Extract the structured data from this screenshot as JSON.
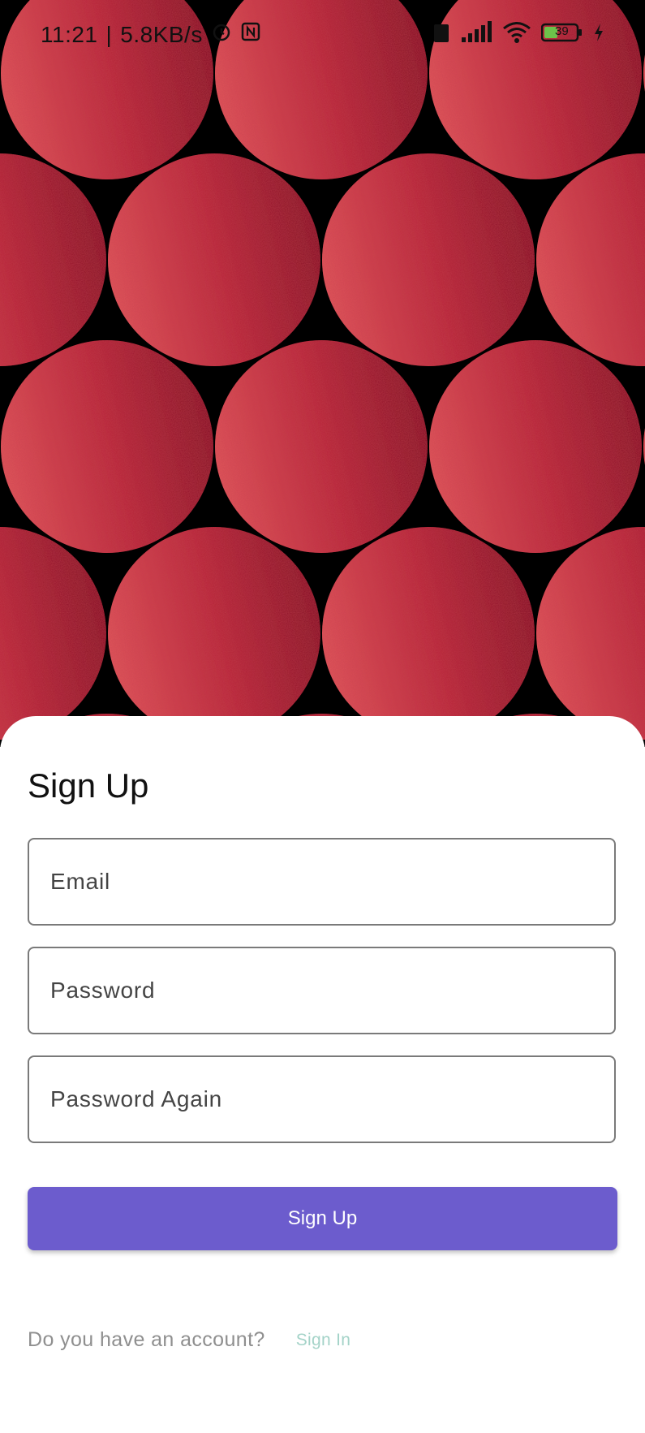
{
  "status_bar": {
    "time": "11:21",
    "separator": "|",
    "speed": "5.8KB/s",
    "battery_level": "39"
  },
  "sheet": {
    "title": "Sign Up",
    "email_placeholder": "Email",
    "password_placeholder": "Password",
    "password_again_placeholder": "Password Again",
    "submit_label": "Sign Up",
    "footer_prompt": "Do you have an account?",
    "sign_in_link": "Sign In"
  },
  "colors": {
    "primary": "#6c5ccd",
    "link": "#a4d3c8",
    "circle_light": "#e0565b",
    "circle_dark": "#7a0d20",
    "background": "#000000"
  },
  "icons": {
    "status_left": [
      "alarm-icon",
      "nfc-icon"
    ],
    "status_right": [
      "sim-icon",
      "signal-icon",
      "wifi-icon",
      "battery-icon",
      "charging-icon"
    ]
  }
}
